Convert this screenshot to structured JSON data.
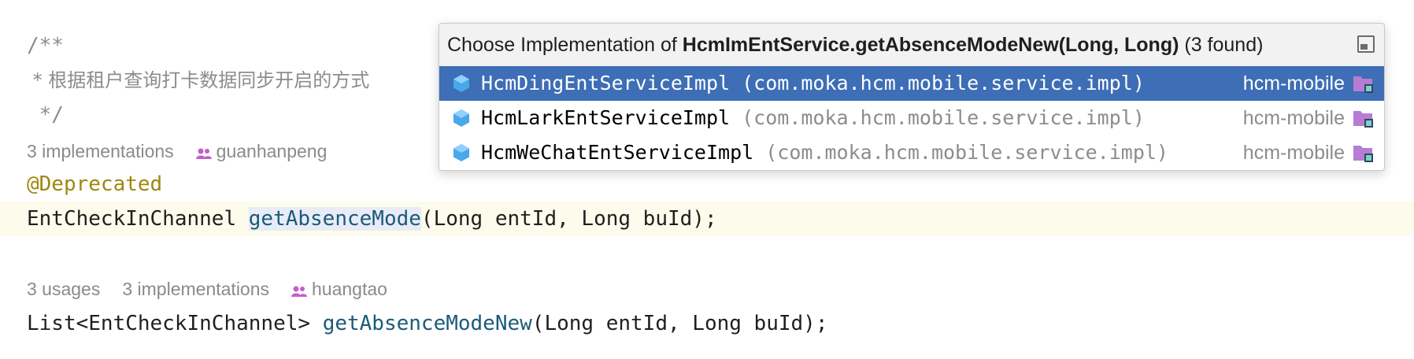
{
  "editor": {
    "comment_open": "/**",
    "comment_body": " * 根据租户查询打卡数据同步开启的方式",
    "comment_close": " */",
    "hint1": {
      "implementations": "3 implementations",
      "author": "guanhanpeng"
    },
    "annotation": "@Deprecated",
    "line1": {
      "return_type": "EntCheckInChannel ",
      "method": "getAbsenceMode",
      "params": "(Long entId, Long buId);"
    },
    "hint2": {
      "usages": "3 usages",
      "implementations": "3 implementations",
      "author": "huangtao"
    },
    "line2": {
      "return_type": "List<EntCheckInChannel> ",
      "method": "getAbsenceModeNew",
      "params": "(Long entId, Long buId);"
    }
  },
  "popup": {
    "title_prefix": "Choose Implementation of ",
    "title_target": "HcmImEntService.getAbsenceModeNew(Long, Long)",
    "title_suffix": " (3 found)",
    "items": [
      {
        "name": "HcmDingEntServiceImpl",
        "package": " (com.moka.hcm.mobile.service.impl)",
        "module": "hcm-mobile",
        "selected": true
      },
      {
        "name": "HcmLarkEntServiceImpl",
        "package": " (com.moka.hcm.mobile.service.impl)",
        "module": "hcm-mobile",
        "selected": false
      },
      {
        "name": "HcmWeChatEntServiceImpl",
        "package": " (com.moka.hcm.mobile.service.impl)",
        "module": "hcm-mobile",
        "selected": false
      }
    ]
  },
  "colors": {
    "selection": "#3d6eb6",
    "class_icon": "#4aa8e8",
    "module_folder": "#b77cd6",
    "author_icon": "#c45ec8"
  }
}
